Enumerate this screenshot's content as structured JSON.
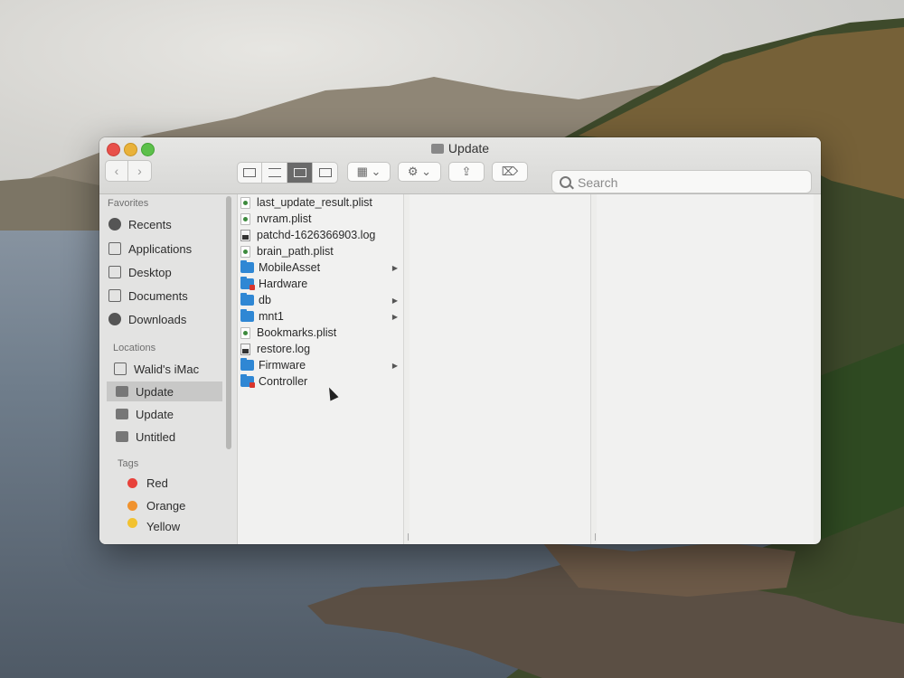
{
  "window": {
    "title": "Update"
  },
  "toolbar": {
    "back_icon": "chevron-left-icon",
    "forward_icon": "chevron-right-icon",
    "views": [
      "icon-view-icon",
      "list-view-icon",
      "column-view-icon",
      "gallery-view-icon"
    ],
    "active_view": "column-view-icon",
    "group_icon": "group-by-icon",
    "action_icon": "gear-icon",
    "share_icon": "share-icon",
    "tag_icon": "tag-icon",
    "search_placeholder": "Search"
  },
  "sidebar": {
    "favorites_heading": "Favorites",
    "favorites": [
      {
        "label": "Recents",
        "icon": "clock-icon"
      },
      {
        "label": "Applications",
        "icon": "applications-icon"
      },
      {
        "label": "Desktop",
        "icon": "desktop-icon"
      },
      {
        "label": "Documents",
        "icon": "document-icon"
      },
      {
        "label": "Downloads",
        "icon": "download-icon"
      }
    ],
    "locations_heading": "Locations",
    "locations": [
      {
        "label": "Walid's iMac",
        "icon": "imac-icon"
      },
      {
        "label": "Update",
        "icon": "drive-icon",
        "selected": true
      },
      {
        "label": "Update",
        "icon": "drive-icon"
      },
      {
        "label": "Untitled",
        "icon": "drive-icon"
      }
    ],
    "tags_heading": "Tags",
    "tags": [
      {
        "label": "Red",
        "color": "#e8423b"
      },
      {
        "label": "Orange",
        "color": "#f0922e"
      },
      {
        "label": "Yellow",
        "color": "#f2c230"
      }
    ]
  },
  "files": [
    {
      "name": "last_update_result.plist",
      "type": "plist"
    },
    {
      "name": "nvram.plist",
      "type": "plist"
    },
    {
      "name": "patchd-1626366903.log",
      "type": "log"
    },
    {
      "name": "brain_path.plist",
      "type": "plist"
    },
    {
      "name": "MobileAsset",
      "type": "folder",
      "has_children": true
    },
    {
      "name": "Hardware",
      "type": "folder-locked"
    },
    {
      "name": "db",
      "type": "folder",
      "has_children": true
    },
    {
      "name": "mnt1",
      "type": "folder",
      "has_children": true
    },
    {
      "name": "Bookmarks.plist",
      "type": "plist"
    },
    {
      "name": "restore.log",
      "type": "log"
    },
    {
      "name": "Firmware",
      "type": "folder",
      "has_children": true
    },
    {
      "name": "Controller",
      "type": "folder-locked"
    }
  ]
}
